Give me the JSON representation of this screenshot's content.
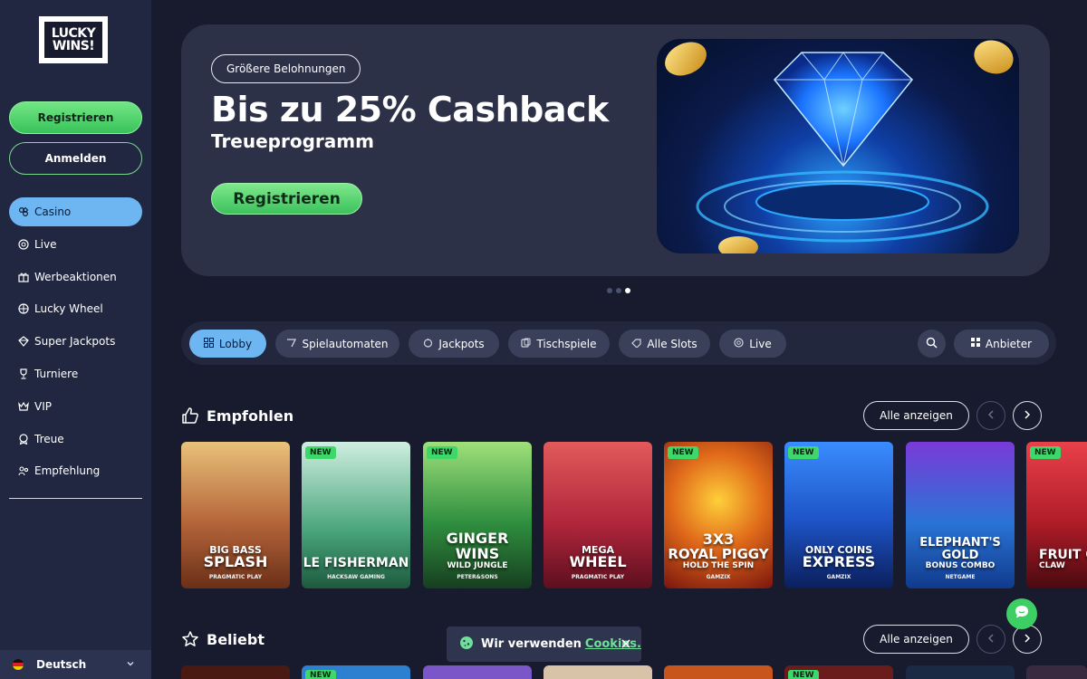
{
  "brand": {
    "logo_line1": "LUCKY",
    "logo_line2": "WINS!"
  },
  "sidebar": {
    "register_label": "Registrieren",
    "login_label": "Anmelden",
    "items": [
      {
        "label": "Casino",
        "icon": "casino-icon",
        "active": true
      },
      {
        "label": "Live",
        "icon": "live-chip-icon"
      },
      {
        "label": "Werbeaktionen",
        "icon": "gift-icon"
      },
      {
        "label": "Lucky Wheel",
        "icon": "wheel-icon"
      },
      {
        "label": "Super Jackpots",
        "icon": "jackpot-icon"
      },
      {
        "label": "Turniere",
        "icon": "trophy-icon"
      },
      {
        "label": "VIP",
        "icon": "crown-icon"
      },
      {
        "label": "Treue",
        "icon": "loyalty-icon"
      },
      {
        "label": "Empfehlung",
        "icon": "referral-icon"
      }
    ],
    "language": "Deutsch"
  },
  "hero": {
    "tag": "Größere Belohnungen",
    "title": "Bis zu 25% Cashback",
    "subtitle": "Treueprogramm",
    "cta": "Registrieren",
    "slides_total": 3,
    "active_slide": 3
  },
  "categories": [
    {
      "label": "Lobby",
      "icon": "lobby-icon",
      "active": true
    },
    {
      "label": "Spielautomaten",
      "icon": "slot-icon"
    },
    {
      "label": "Jackpots",
      "icon": "jackpot-icon"
    },
    {
      "label": "Tischspiele",
      "icon": "table-games-icon"
    },
    {
      "label": "Alle Slots",
      "icon": "all-slots-icon"
    },
    {
      "label": "Live",
      "icon": "live-icon"
    }
  ],
  "providers_label": "Anbieter",
  "sections": {
    "recommended": {
      "title": "Empfohlen",
      "show_all": "Alle anzeigen",
      "games": [
        {
          "l1": "BIG BASS",
          "l2": "SPLASH",
          "provider": "PRAGMATIC PLAY",
          "new": false,
          "color": "#b5653a"
        },
        {
          "l1": "",
          "l2": "LE FISHERMAN",
          "provider": "HACKSAW GAMING",
          "new": true,
          "color": "#4aa67c"
        },
        {
          "l1": "",
          "l2": "GINGER WINS",
          "l3": "WILD JUNGLE",
          "provider": "PETER&SONS",
          "new": true,
          "color": "#2f8f3f"
        },
        {
          "l1": "MEGA",
          "l2": "WHEEL",
          "provider": "PRAGMATIC PLAY",
          "new": false,
          "color": "#b2263c"
        },
        {
          "l1": "3X3",
          "l2": "ROYAL PIGGY",
          "l3": "HOLD THE SPIN",
          "provider": "GAMZIX",
          "new": true,
          "color": "#c2381c"
        },
        {
          "l1": "ONLY COINS",
          "l2": "EXPRESS",
          "provider": "GAMZIX",
          "new": true,
          "color": "#1d52c4"
        },
        {
          "l1": "",
          "l2": "ELEPHANT'S GOLD",
          "l3": "BONUS COMBO",
          "provider": "NETGAME",
          "new": false,
          "color": "#2a74d6"
        },
        {
          "l1": "",
          "l2": "FRUIT GEMS",
          "l3": "CLAW",
          "provider": "CLAWBUSTER",
          "new": true,
          "color": "#b01c28"
        }
      ]
    },
    "popular": {
      "title": "Beliebt",
      "show_all": "Alle anzeigen",
      "new_label": "NEW"
    }
  },
  "cookie": {
    "text": "Wir verwenden",
    "link": "Cookies."
  },
  "colors": {
    "accent_green": "#3dcf64",
    "accent_blue": "#6eb6f2",
    "background": "#171b2d"
  }
}
